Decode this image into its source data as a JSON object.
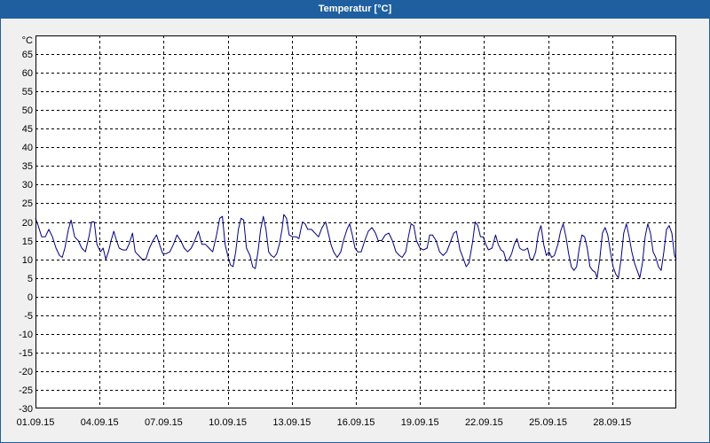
{
  "window": {
    "title_bar_color": "#1f5f9f",
    "background_color": "#f0f0f0",
    "plot_background_color": "#ffffff"
  },
  "chart_data": {
    "type": "line",
    "title": "Temperatur [°C]",
    "ylabel": "°C",
    "xlim": [
      "01.09.15 00:00",
      "01.10.15 00:00"
    ],
    "ylim": [
      -30,
      70
    ],
    "grid": true,
    "xticks": [
      "01.09.15",
      "04.09.15",
      "07.09.15",
      "10.09.15",
      "13.09.15",
      "16.09.15",
      "19.09.15",
      "22.09.15",
      "25.09.15",
      "28.09.15"
    ],
    "yticks": [
      65,
      60,
      55,
      50,
      45,
      40,
      35,
      30,
      25,
      20,
      15,
      10,
      5,
      0,
      -5,
      -10,
      -15,
      -20,
      -25,
      -30
    ],
    "x": [
      "01.09.15 00:00",
      "01.09.15 03:00",
      "01.09.15 07:00",
      "01.09.15 11:00",
      "01.09.15 15:00",
      "01.09.15 19:00",
      "01.09.15 23:00",
      "02.09.15 03:00",
      "02.09.15 06:00",
      "02.09.15 09:00",
      "02.09.15 13:00",
      "02.09.15 16:00",
      "02.09.15 20:00",
      "03.09.15 00:00",
      "03.09.15 04:00",
      "03.09.15 08:00",
      "03.09.15 12:00",
      "03.09.15 15:00",
      "03.09.15 18:00",
      "03.09.15 21:00",
      "04.09.15 01:00",
      "04.09.15 04:00",
      "04.09.15 07:00",
      "04.09.15 10:00",
      "04.09.15 13:00",
      "04.09.15 16:00",
      "04.09.15 19:00",
      "04.09.15 22:00",
      "05.09.15 02:00",
      "05.09.15 06:00",
      "05.09.15 09:00",
      "05.09.15 13:00",
      "05.09.15 16:00",
      "05.09.15 20:00",
      "06.09.15 00:00",
      "06.09.15 04:00",
      "06.09.15 08:00",
      "06.09.15 12:00",
      "06.09.15 16:00",
      "06.09.15 20:00",
      "06.09.15 23:00",
      "07.09.15 03:00",
      "07.09.15 07:00",
      "07.09.15 11:00",
      "07.09.15 15:00",
      "07.09.15 19:00",
      "07.09.15 23:00",
      "08.09.15 03:00",
      "08.09.15 07:00",
      "08.09.15 11:00",
      "08.09.15 15:00",
      "08.09.15 19:00",
      "08.09.15 23:00",
      "09.09.15 03:00",
      "09.09.15 07:00",
      "09.09.15 11:00",
      "09.09.15 15:00",
      "09.09.15 18:00",
      "09.09.15 21:00",
      "10.09.15 00:00",
      "10.09.15 03:00",
      "10.09.15 06:00",
      "10.09.15 09:00",
      "10.09.15 12:00",
      "10.09.15 15:00",
      "10.09.15 18:00",
      "10.09.15 21:00",
      "11.09.15 01:00",
      "11.09.15 04:00",
      "11.09.15 07:00",
      "11.09.15 10:00",
      "11.09.15 13:00",
      "11.09.15 16:00",
      "11.09.15 19:00",
      "11.09.15 22:00",
      "12.09.15 01:00",
      "12.09.15 04:00",
      "12.09.15 07:00",
      "12.09.15 10:00",
      "12.09.15 13:00",
      "12.09.15 15:00",
      "12.09.15 18:00",
      "12.09.15 21:00",
      "13.09.15 01:00",
      "13.09.15 05:00",
      "13.09.15 08:00",
      "13.09.15 12:00",
      "13.09.15 15:00",
      "13.09.15 18:00",
      "13.09.15 22:00",
      "14.09.15 02:00",
      "14.09.15 06:00",
      "14.09.15 10:00",
      "14.09.15 14:00",
      "14.09.15 17:00",
      "14.09.15 20:00",
      "14.09.15 23:00",
      "15.09.15 03:00",
      "15.09.15 07:00",
      "15.09.15 10:00",
      "15.09.15 14:00",
      "15.09.15 17:00",
      "15.09.15 20:00",
      "15.09.15 23:00",
      "16.09.15 02:00",
      "16.09.15 06:00",
      "16.09.15 10:00",
      "16.09.15 14:00",
      "16.09.15 18:00",
      "16.09.15 22:00",
      "17.09.15 01:00",
      "17.09.15 05:00",
      "17.09.15 09:00",
      "17.09.15 13:00",
      "17.09.15 17:00",
      "17.09.15 21:00",
      "18.09.15 01:00",
      "18.09.15 04:00",
      "18.09.15 08:00",
      "18.09.15 11:00",
      "18.09.15 14:00",
      "18.09.15 17:00",
      "18.09.15 20:00",
      "19.09.15 00:00",
      "19.09.15 04:00",
      "19.09.15 08:00",
      "19.09.15 11:00",
      "19.09.15 14:00",
      "19.09.15 18:00",
      "19.09.15 22:00",
      "20.09.15 02:00",
      "20.09.15 06:00",
      "20.09.15 10:00",
      "20.09.15 14:00",
      "20.09.15 17:00",
      "20.09.15 21:00",
      "21.09.15 01:00",
      "21.09.15 04:00",
      "21.09.15 07:00",
      "21.09.15 11:00",
      "21.09.15 14:00",
      "21.09.15 17:00",
      "21.09.15 20:00",
      "21.09.15 23:00",
      "22.09.15 02:00",
      "22.09.15 05:00",
      "22.09.15 09:00",
      "22.09.15 13:00",
      "22.09.15 16:00",
      "22.09.15 19:00",
      "22.09.15 22:00",
      "23.09.15 01:00",
      "23.09.15 04:00",
      "23.09.15 07:00",
      "23.09.15 10:00",
      "23.09.15 13:00",
      "23.09.15 16:00",
      "23.09.15 19:00",
      "23.09.15 22:00",
      "24.09.15 01:00",
      "24.09.15 04:00",
      "24.09.15 07:00",
      "24.09.15 10:00",
      "24.09.15 13:00",
      "24.09.15 16:00",
      "24.09.15 19:00",
      "24.09.15 22:00",
      "25.09.15 01:00",
      "25.09.15 04:00",
      "25.09.15 07:00",
      "25.09.15 11:00",
      "25.09.15 14:00",
      "25.09.15 17:00",
      "25.09.15 20:00",
      "25.09.15 23:00",
      "26.09.15 02:00",
      "26.09.15 05:00",
      "26.09.15 08:00",
      "26.09.15 11:00",
      "26.09.15 14:00",
      "26.09.15 17:00",
      "26.09.15 20:00",
      "26.09.15 23:00",
      "27.09.15 02:00",
      "27.09.15 05:00",
      "27.09.15 07:00",
      "27.09.15 10:00",
      "27.09.15 13:00",
      "27.09.15 16:00",
      "27.09.15 19:00",
      "27.09.15 22:00",
      "28.09.15 01:00",
      "28.09.15 04:00",
      "28.09.15 07:00",
      "28.09.15 10:00",
      "28.09.15 13:00",
      "28.09.15 16:00",
      "28.09.15 19:00",
      "28.09.15 22:00",
      "29.09.15 01:00",
      "29.09.15 04:00",
      "29.09.15 07:00",
      "29.09.15 10:00",
      "29.09.15 13:00",
      "29.09.15 16:00",
      "29.09.15 19:00",
      "29.09.15 22:00",
      "30.09.15 01:00",
      "30.09.15 04:00",
      "30.09.15 07:00",
      "30.09.15 10:00",
      "30.09.15 13:00",
      "30.09.15 16:00",
      "30.09.15 19:00",
      "30.09.15 22:00",
      "01.10.15 00:00"
    ],
    "series": [
      {
        "color": "#000080",
        "values": [
          21,
          19,
          16,
          16,
          18,
          16,
          13,
          11,
          10.5,
          13,
          18,
          20.5,
          16,
          15,
          13,
          12,
          16,
          20,
          20,
          14,
          12,
          13,
          10,
          12,
          15,
          17.5,
          15,
          13,
          12.5,
          12.5,
          14,
          17,
          12,
          11,
          10,
          10,
          13,
          15,
          16.5,
          13.5,
          11.5,
          11.5,
          12,
          14,
          16.5,
          15,
          13,
          12,
          13,
          15,
          17.5,
          14,
          14,
          13,
          12,
          16,
          21,
          21.5,
          14,
          11,
          8.5,
          8,
          12,
          18,
          21,
          20.5,
          13,
          11,
          8,
          7.5,
          12,
          18,
          21.5,
          18,
          12,
          11,
          10.5,
          11.5,
          14,
          18,
          22,
          21,
          16.5,
          16,
          16,
          15.5,
          20,
          19.5,
          18,
          18,
          17,
          16,
          18.5,
          20,
          17,
          14,
          12,
          10.5,
          12,
          15,
          18,
          19.5,
          16.5,
          13,
          12,
          12,
          15,
          17.5,
          18.5,
          17,
          15,
          15,
          16.5,
          17,
          15,
          12,
          11,
          10.5,
          12,
          16,
          19.5,
          19,
          15,
          13,
          12.5,
          13,
          16.5,
          16.5,
          15,
          12,
          11,
          12,
          14.5,
          17,
          17.5,
          12.5,
          10,
          8,
          9,
          14.5,
          20,
          19,
          16,
          16,
          14,
          12.5,
          13,
          16.5,
          14,
          12.5,
          12,
          9.5,
          10,
          11.5,
          14,
          15.5,
          13,
          12.5,
          12.5,
          13,
          10,
          10,
          12,
          17,
          19,
          14,
          11,
          12,
          10.5,
          11,
          14,
          17.5,
          19.5,
          16,
          11.5,
          8,
          7,
          8,
          13,
          16.5,
          16,
          13,
          8,
          7,
          6.5,
          5,
          10,
          17,
          18.5,
          16.5,
          12,
          8,
          6,
          5,
          10,
          17,
          19.5,
          16,
          12,
          9,
          7,
          5,
          9,
          16,
          19.5,
          17,
          12,
          10.5,
          8,
          7,
          12,
          18,
          19,
          17,
          11,
          10
        ]
      }
    ]
  }
}
